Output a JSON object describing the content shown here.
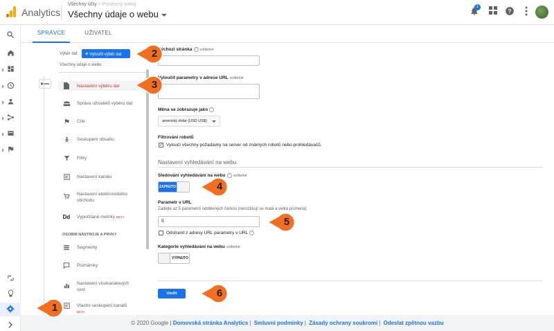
{
  "header": {
    "app_name": "Analytics",
    "account_path": "Všechny účty",
    "account_blurred": "> Prostorný pokoj",
    "view_title": "Všechny údaje o webu",
    "notification_count": "1"
  },
  "tabs": [
    {
      "label": "SPRÁVCE"
    },
    {
      "label": "UŽIVATEL"
    }
  ],
  "admin": {
    "selector_label": "Výběr dat",
    "create_button": "Vytvořit výběr dat",
    "view_name": "Všechny údaje o webu",
    "menu": [
      {
        "label": "Nastavení výběru dat",
        "icon": "document-icon"
      },
      {
        "label": "Správa uživatelů výběru dat",
        "icon": "users-icon"
      },
      {
        "label": "Cíle",
        "icon": "flag-icon"
      },
      {
        "label": "Seskupení obsahu",
        "icon": "person-icon"
      },
      {
        "label": "Filtry",
        "icon": "filter-icon"
      },
      {
        "label": "Nastavení kanálu",
        "icon": "channel-icon"
      },
      {
        "label": "Nastavení elektronického",
        "label2": "obchodu",
        "icon": "cart-icon"
      },
      {
        "label": "Vypočítané metriky",
        "badge": "BETA",
        "icon": "dd-icon"
      },
      {
        "label": "Segmenty",
        "icon": "segments-icon"
      },
      {
        "label": "Poznámky",
        "icon": "notes-icon"
      },
      {
        "label": "Nastavení vícekanálových",
        "label2": "cest",
        "icon": "bars-icon"
      },
      {
        "label": "Vlastní seskupení kanálů",
        "badge": "BETA",
        "icon": "channel-group-icon"
      }
    ],
    "section_heading": "OSOBNÍ NÁSTROJE A PRVKY"
  },
  "form": {
    "default_page_label": "Výchozí stránka",
    "optional": "volitelné",
    "exclude_params_label": "Vyloučit parametry v adrese URL",
    "currency_label": "Měna se zobrazuje jako",
    "currency_value": "americký dolar (USD US$)",
    "bot_filter_label": "Filtrování robotů",
    "bot_filter_text": "Vyloučí všechny požadavky na server od známých robotů nebo prohledávačů.",
    "site_search_section": "Nastavení vyhledávání na webu",
    "site_search_tracking_label": "Sledování vyhledávání na webu",
    "toggle_on": "ZAPNUTO",
    "url_param_label": "Parametr v URL",
    "url_param_hint": "Zadejte až 5 parametrů oddělených čárkou (nerozlišují se malá a velká písmena)",
    "url_param_value": "q",
    "strip_param_text": "Odstranit z adresy URL parametry v URL",
    "category_label": "Kategorie vyhledávání na webu",
    "toggle_off": "VYPNUTO",
    "save_button": "Uložit"
  },
  "footer": {
    "copyright": "© 2020 Google |",
    "links": [
      "Domovská stránka Analytics",
      "Smluvní podmínky",
      "Zásady ochrany soukromí",
      "Odeslat zpětnou vazbu"
    ]
  },
  "callouts": [
    "1",
    "2",
    "3",
    "4",
    "5",
    "6"
  ],
  "colors": {
    "accent": "#1a73e8",
    "callout": "#f26f21",
    "active_menu": "#d93025"
  }
}
